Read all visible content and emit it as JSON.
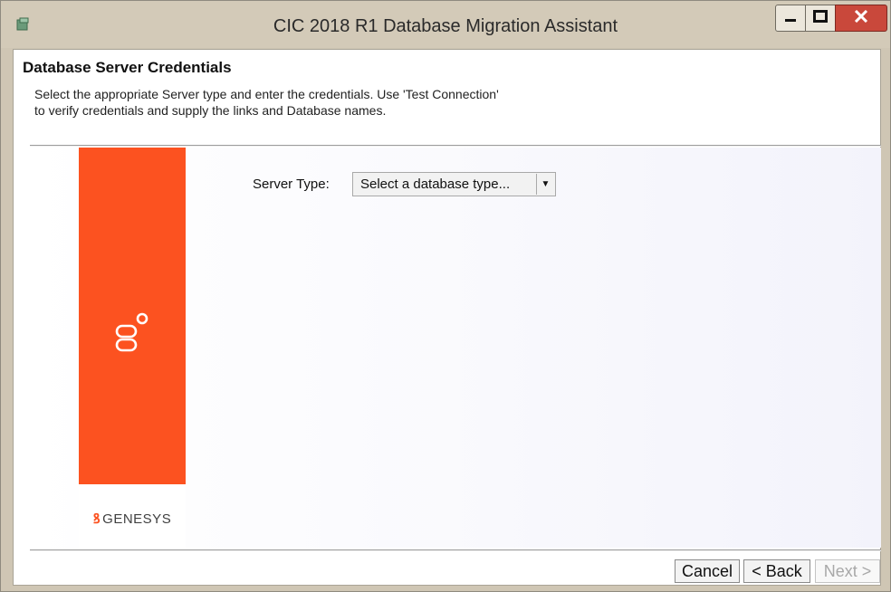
{
  "window": {
    "title": "CIC 2018 R1 Database Migration Assistant",
    "icon": "app-icon",
    "controls": {
      "minimize": "minimize-icon",
      "maximize": "maximize-icon",
      "close": "close-icon"
    }
  },
  "header": {
    "title": "Database Server Credentials",
    "description": "Select the appropriate Server type and enter the credentials.  Use 'Test Connection' to verify credentials and supply the links and Database names."
  },
  "brand": {
    "name": "GENESYS",
    "color": "#fc5220"
  },
  "form": {
    "server_type_label": "Server Type:",
    "server_type_value": "Select a database type..."
  },
  "footer": {
    "cancel_label": "Cancel",
    "back_label": "< Back",
    "next_label": "Next >"
  }
}
